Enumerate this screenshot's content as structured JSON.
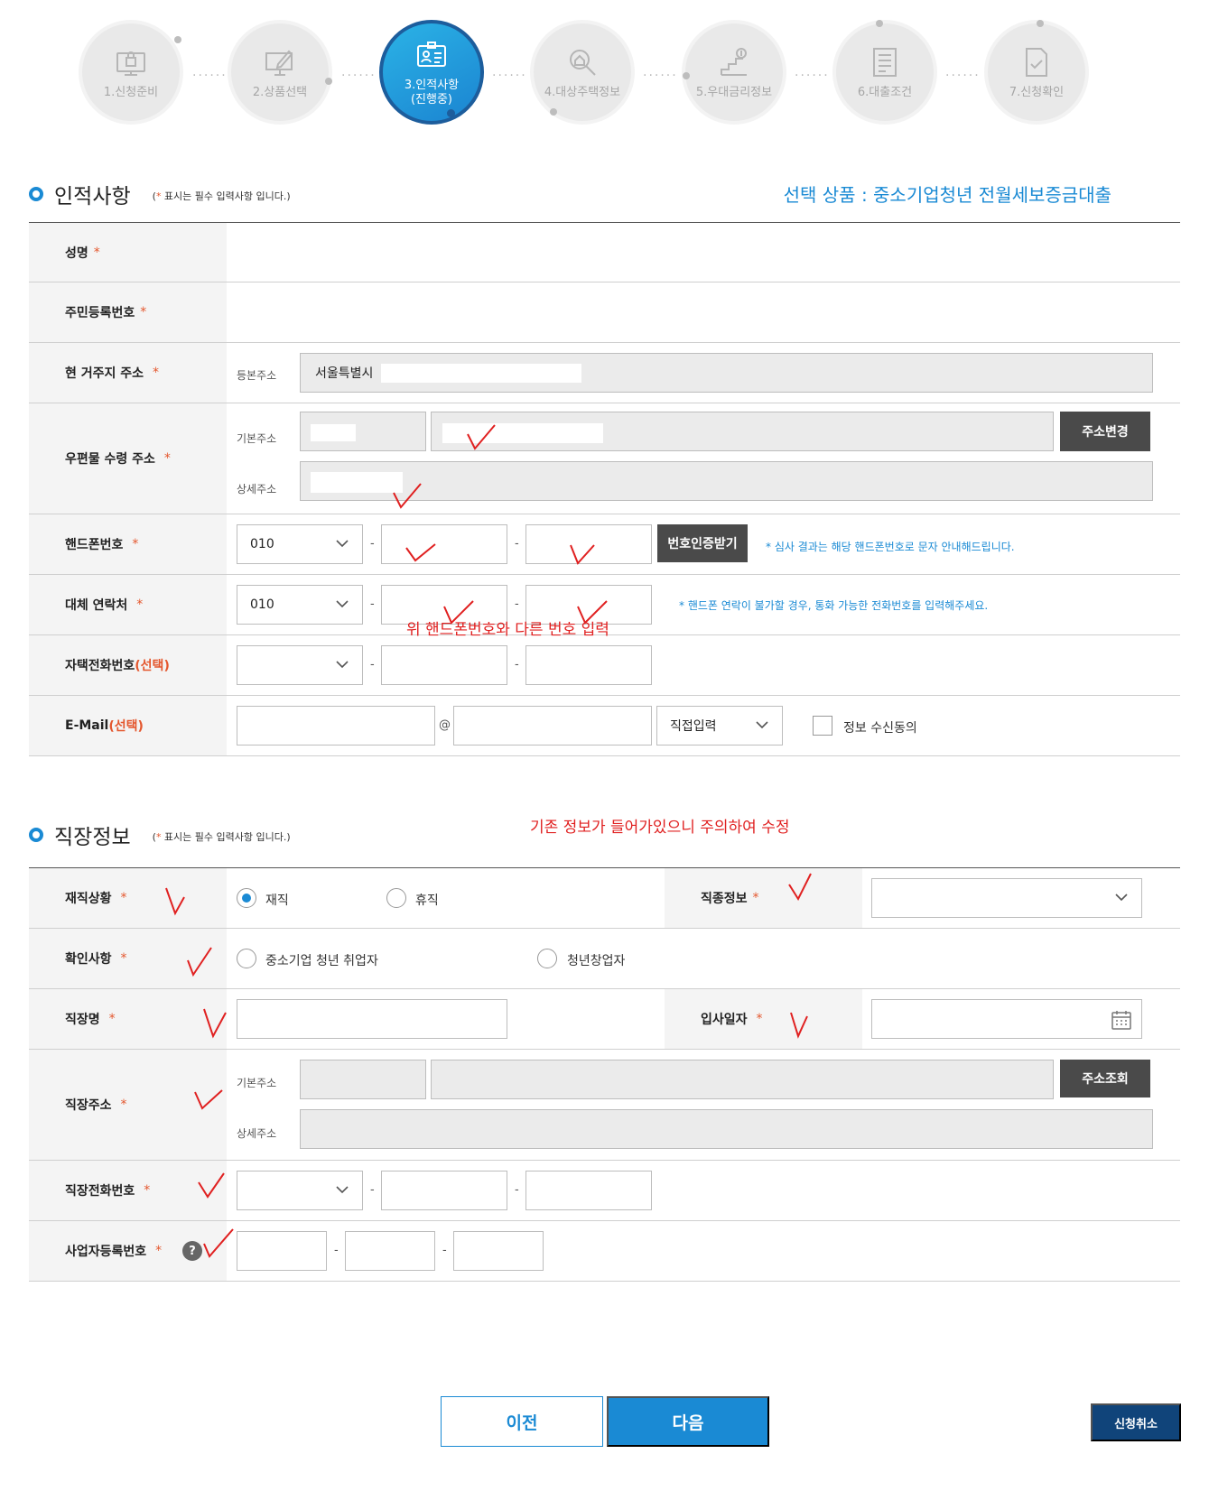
{
  "steps": [
    {
      "label": "1.신청준비",
      "icon": "monitor-lock-icon"
    },
    {
      "label": "2.상품선택",
      "icon": "computer-pen-icon"
    },
    {
      "label": "3.인적사항",
      "sub": "(진행중)",
      "icon": "id-card-icon"
    },
    {
      "label": "4.대상주택정보",
      "icon": "house-search-icon"
    },
    {
      "label": "5.우대금리정보",
      "icon": "stairs-coin-icon"
    },
    {
      "label": "6.대출조건",
      "icon": "document-list-icon"
    },
    {
      "label": "7.신청확인",
      "icon": "document-check-icon"
    }
  ],
  "personal": {
    "title": "인적사항",
    "note_star": "*",
    "note": " 표시는 필수 입력사항 입니다.",
    "note_open": "(",
    "note_close": ")",
    "product_label": "선택 상품 : 중소기업청년 전월세보증금대출",
    "name_label": "성명",
    "rrn_label": "주민등록번호",
    "address_label": "현 거주지 주소",
    "address_sub": "등본주소",
    "address_value": "서울특별시",
    "mail_addr_label": "우편물 수령 주소",
    "mail_basic": "기본주소",
    "mail_detail": "상세주소",
    "change_addr_btn": "주소변경",
    "mobile_label": "핸드폰번호",
    "mobile_prefix": "010",
    "verify_btn": "번호인증받기",
    "mobile_hint": "* 심사 결과는 해당 핸드폰번호로 문자 안내해드립니다.",
    "alt_label": "대체 연락처",
    "alt_prefix": "010",
    "alt_hint": "* 핸드폰 연락이 불가할 경우, 통화 가능한 전화번호를 입력해주세요.",
    "alt_note": "위 핸드폰번호와 다른 번호 입력",
    "home_label": "자택전화번호",
    "home_opt": "(선택)",
    "email_label": "E-Mail",
    "email_opt": "(선택)",
    "email_at": "@",
    "email_domain": "직접입력",
    "email_consent": "정보 수신동의"
  },
  "job": {
    "title": "직장정보",
    "note_star": "*",
    "note": " 표시는 필수 입력사항 입니다.",
    "note_open": "(",
    "note_close": ")",
    "warning": "기존 정보가 들어가있으니 주의하여 수정",
    "status_label": "재직상황",
    "status_employed": "재직",
    "status_leave": "휴직",
    "occupation_label": "직종정보",
    "confirm_label": "확인사항",
    "confirm_opt1": "중소기업 청년 취업자",
    "confirm_opt2": "청년창업자",
    "company_label": "직장명",
    "join_date_label": "입사일자",
    "company_addr_label": "직장주소",
    "addr_basic": "기본주소",
    "addr_detail": "상세주소",
    "search_addr_btn": "주소조회",
    "company_phone_label": "직장전화번호",
    "biz_no_label": "사업자등록번호",
    "help": "?"
  },
  "required_mark": "*",
  "dash": "-",
  "buttons": {
    "prev": "이전",
    "next": "다음",
    "cancel": "신청취소"
  },
  "colors": {
    "accent": "#1a8ad4",
    "required": "#e4572e",
    "annotation": "#e02020",
    "dark_button": "#4a4a4a",
    "cancel_button": "#10447a"
  }
}
